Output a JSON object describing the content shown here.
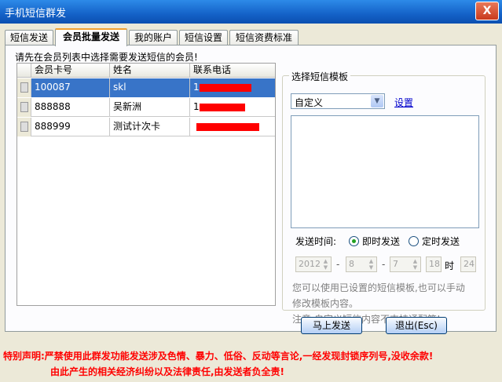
{
  "window": {
    "title": "手机短信群发",
    "close_label": "X"
  },
  "tabs": [
    {
      "label": "短信发送",
      "active": false
    },
    {
      "label": "会员批量发送",
      "active": true
    },
    {
      "label": "我的账户",
      "active": false
    },
    {
      "label": "短信设置",
      "active": false
    },
    {
      "label": "短信资费标准",
      "active": false
    }
  ],
  "member_panel": {
    "hint": "请先在会员列表中选择需要发送短信的会员!",
    "columns": [
      "会员卡号",
      "姓名",
      "联系电话"
    ],
    "rows": [
      {
        "card_no": "100087",
        "name": "skl",
        "phone": "1",
        "selected": true
      },
      {
        "card_no": "888888",
        "name": "吴新洲",
        "phone": "1",
        "selected": false
      },
      {
        "card_no": "888999",
        "name": "测试计次卡",
        "phone": "",
        "selected": false
      }
    ]
  },
  "template_panel": {
    "legend": "选择短信模板",
    "selected_template": "自定义",
    "settings_link": "设置",
    "message_text": "",
    "send_time_label": "发送时间:",
    "radio_now": "即时发送",
    "radio_scheduled": "定时发送",
    "schedule": {
      "year": "2012",
      "month": "8",
      "day": "7",
      "hour": "18",
      "minute": "24",
      "sep1": "-",
      "sep2": "-",
      "hour_suffix": "时"
    },
    "note1_line1": "您可以使用已设置的短信模板,也可以手动",
    "note1_line2": "修改模板内容。",
    "note2": "注意:自定义短信内容不支持通配符!"
  },
  "buttons": {
    "send": "马上发送",
    "exit": "退出(Esc)"
  },
  "disclaimer": {
    "line1": "特别声明:严禁使用此群发功能发送涉及色情、暴力、低俗、反动等言论,一经发现封锁序列号,没收余款!",
    "line2": "由此产生的相关经济纠纷以及法律责任,由发送者负全责!"
  },
  "colors": {
    "selection": "#3874c8",
    "disclaimer": "#ff0000",
    "redaction": "#ff0000"
  }
}
